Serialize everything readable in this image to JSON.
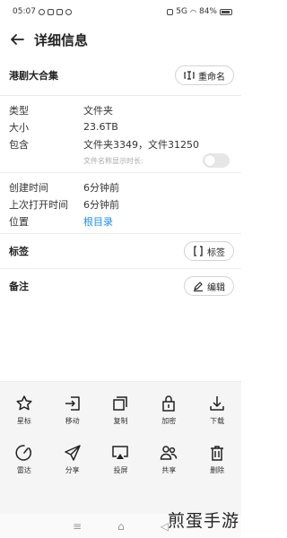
{
  "status_bar": {
    "time": "05:07",
    "signal": "5G",
    "battery": "84%"
  },
  "header": {
    "title": "详细信息",
    "back_icon": "arrow-left-icon"
  },
  "folder": {
    "name": "港剧大合集",
    "rename_label": "重命名"
  },
  "details": [
    {
      "label": "类型",
      "value": "文件夹"
    },
    {
      "label": "大小",
      "value": "23.6TB"
    },
    {
      "label": "包含",
      "value": "文件夹3349，文件31250"
    }
  ],
  "toggle": {
    "label": "文件名称显示时长:",
    "on": false
  },
  "times": [
    {
      "label": "创建时间",
      "value": "6分钟前"
    },
    {
      "label": "上次打开时间",
      "value": "6分钟前"
    },
    {
      "label": "位置",
      "value": "根目录",
      "link": true
    }
  ],
  "tags": {
    "title": "标签",
    "button_label": "标签"
  },
  "notes": {
    "title": "备注",
    "button_label": "编辑"
  },
  "actions": [
    {
      "label": "星标",
      "icon": "star-icon"
    },
    {
      "label": "移动",
      "icon": "move-icon"
    },
    {
      "label": "复制",
      "icon": "copy-icon"
    },
    {
      "label": "加密",
      "icon": "lock-icon"
    },
    {
      "label": "下载",
      "icon": "download-icon"
    },
    {
      "label": "雷达",
      "icon": "radar-icon"
    },
    {
      "label": "分享",
      "icon": "share-icon"
    },
    {
      "label": "投屏",
      "icon": "cast-icon"
    },
    {
      "label": "共享",
      "icon": "people-icon"
    },
    {
      "label": "删除",
      "icon": "trash-icon"
    }
  ],
  "watermark": "煎蛋手游",
  "colors": {
    "link": "#1a8ef0",
    "sheet_bg": "#f5f5f5"
  }
}
